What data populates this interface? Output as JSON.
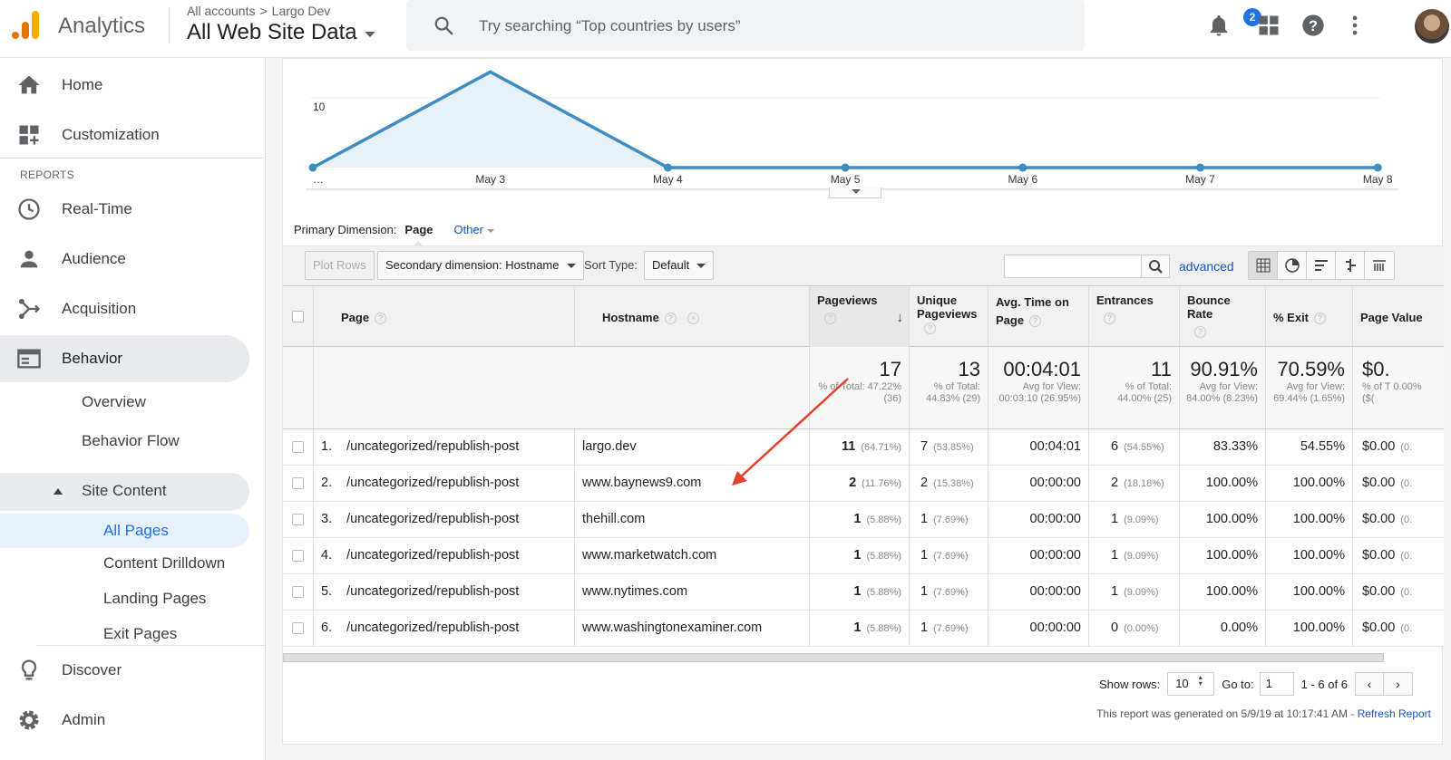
{
  "app": {
    "name": "Analytics",
    "breadcrumb": [
      "All accounts",
      "Largo Dev"
    ],
    "breadcrumb_sep": ">",
    "view_name": "All Web Site Data",
    "search_placeholder": "Try searching “Top countries by users”",
    "notification_count": "2",
    "icons": [
      "analytics-logo-icon",
      "search-icon",
      "bell-icon",
      "apps-grid-icon",
      "help-icon",
      "more-vert-icon"
    ]
  },
  "sidebar": {
    "home": "Home",
    "customization": "Customization",
    "reports_label": "REPORTS",
    "realtime": "Real-Time",
    "audience": "Audience",
    "acquisition": "Acquisition",
    "behavior": "Behavior",
    "behavior_sub": [
      "Overview",
      "Behavior Flow"
    ],
    "site_content": "Site Content",
    "site_content_sub": [
      "All Pages",
      "Content Drilldown",
      "Landing Pages",
      "Exit Pages"
    ],
    "discover": "Discover",
    "admin": "Admin"
  },
  "chart_data": {
    "type": "area",
    "x": [
      "…",
      "May 3",
      "May 4",
      "May 5",
      "May 6",
      "May 7",
      "May 8"
    ],
    "y": [
      0,
      16,
      0,
      0,
      0,
      0,
      0
    ],
    "ytick": "10",
    "color": "#3d8cc4"
  },
  "dimension": {
    "label": "Primary Dimension:",
    "active": "Page",
    "other": "Other"
  },
  "toolbar": {
    "plot_rows": "Plot Rows",
    "secondary_dimension": "Secondary dimension: Hostname",
    "sort_type_label": "Sort Type:",
    "sort_type_value": "Default",
    "advanced": "advanced"
  },
  "table": {
    "headers": {
      "page": "Page",
      "hostname": "Hostname",
      "pageviews": "Pageviews",
      "unique_pageviews": "Unique Pageviews",
      "avg_time": "Avg. Time on Page",
      "entrances": "Entrances",
      "bounce_rate": "Bounce Rate",
      "exit": "% Exit",
      "page_value": "Page Value"
    },
    "totals": {
      "pageviews": "17",
      "pageviews_sub": "% of Total: 47.22% (36)",
      "unique": "13",
      "unique_sub": "% of Total: 44.83% (29)",
      "avg_time": "00:04:01",
      "avg_time_sub": "Avg for View: 00:03:10 (26.95%)",
      "entrances": "11",
      "entrances_sub": "% of Total: 44.00% (25)",
      "bounce": "90.91%",
      "bounce_sub": "Avg for View: 84.00% (8.23%)",
      "exit": "70.59%",
      "exit_sub": "Avg for View: 69.44% (1.65%)",
      "value": "$0.",
      "value_sub": "% of T 0.00% ($("
    },
    "rows": [
      {
        "n": "1.",
        "page": "/uncategorized/republish-post",
        "host": "largo.dev",
        "pv": "11",
        "pv_p": "(64.71%)",
        "upv": "7",
        "upv_p": "(53.85%)",
        "time": "00:04:01",
        "ent": "6",
        "ent_p": "(54.55%)",
        "bounce": "83.33%",
        "exit": "54.55%",
        "value": "$0.00",
        "value_p": "(0."
      },
      {
        "n": "2.",
        "page": "/uncategorized/republish-post",
        "host": "www.baynews9.com",
        "pv": "2",
        "pv_p": "(11.76%)",
        "upv": "2",
        "upv_p": "(15.38%)",
        "time": "00:00:00",
        "ent": "2",
        "ent_p": "(18.18%)",
        "bounce": "100.00%",
        "exit": "100.00%",
        "value": "$0.00",
        "value_p": "(0."
      },
      {
        "n": "3.",
        "page": "/uncategorized/republish-post",
        "host": "thehill.com",
        "pv": "1",
        "pv_p": "(5.88%)",
        "upv": "1",
        "upv_p": "(7.69%)",
        "time": "00:00:00",
        "ent": "1",
        "ent_p": "(9.09%)",
        "bounce": "100.00%",
        "exit": "100.00%",
        "value": "$0.00",
        "value_p": "(0."
      },
      {
        "n": "4.",
        "page": "/uncategorized/republish-post",
        "host": "www.marketwatch.com",
        "pv": "1",
        "pv_p": "(5.88%)",
        "upv": "1",
        "upv_p": "(7.69%)",
        "time": "00:00:00",
        "ent": "1",
        "ent_p": "(9.09%)",
        "bounce": "100.00%",
        "exit": "100.00%",
        "value": "$0.00",
        "value_p": "(0."
      },
      {
        "n": "5.",
        "page": "/uncategorized/republish-post",
        "host": "www.nytimes.com",
        "pv": "1",
        "pv_p": "(5.88%)",
        "upv": "1",
        "upv_p": "(7.69%)",
        "time": "00:00:00",
        "ent": "1",
        "ent_p": "(9.09%)",
        "bounce": "100.00%",
        "exit": "100.00%",
        "value": "$0.00",
        "value_p": "(0."
      },
      {
        "n": "6.",
        "page": "/uncategorized/republish-post",
        "host": "www.washingtonexaminer.com",
        "pv": "1",
        "pv_p": "(5.88%)",
        "upv": "1",
        "upv_p": "(7.69%)",
        "time": "00:00:00",
        "ent": "0",
        "ent_p": "(0.00%)",
        "bounce": "0.00%",
        "exit": "100.00%",
        "value": "$0.00",
        "value_p": "(0."
      }
    ]
  },
  "pager": {
    "show_rows_label": "Show rows:",
    "show_rows_value": "10",
    "goto_label": "Go to:",
    "goto_value": "1",
    "range": "1 - 6 of 6"
  },
  "footer": {
    "generated": "This report was generated on 5/9/19 at 10:17:41 AM -",
    "refresh": "Refresh Report"
  }
}
